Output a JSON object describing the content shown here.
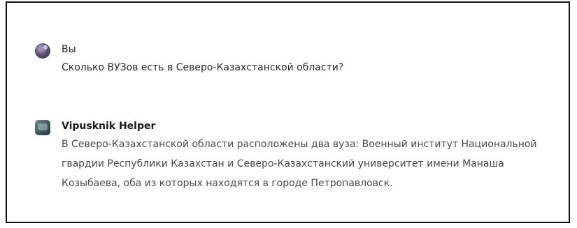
{
  "messages": {
    "user": {
      "author": "Вы",
      "text": "Сколько ВУЗов есть в Северо-Казахстанской области?",
      "avatar_icon": "user-avatar-icon"
    },
    "bot": {
      "author": "Vipusknik Helper",
      "text": "В Северо-Казахстанской области расположены два вуза: Военный институт Национальной гвардии Республики Казахстан и Северо-Казахстанский университет имени Манаша Козыбаева, оба из которых находятся в городе Петропавловск.",
      "avatar_icon": "bot-avatar-icon"
    }
  }
}
